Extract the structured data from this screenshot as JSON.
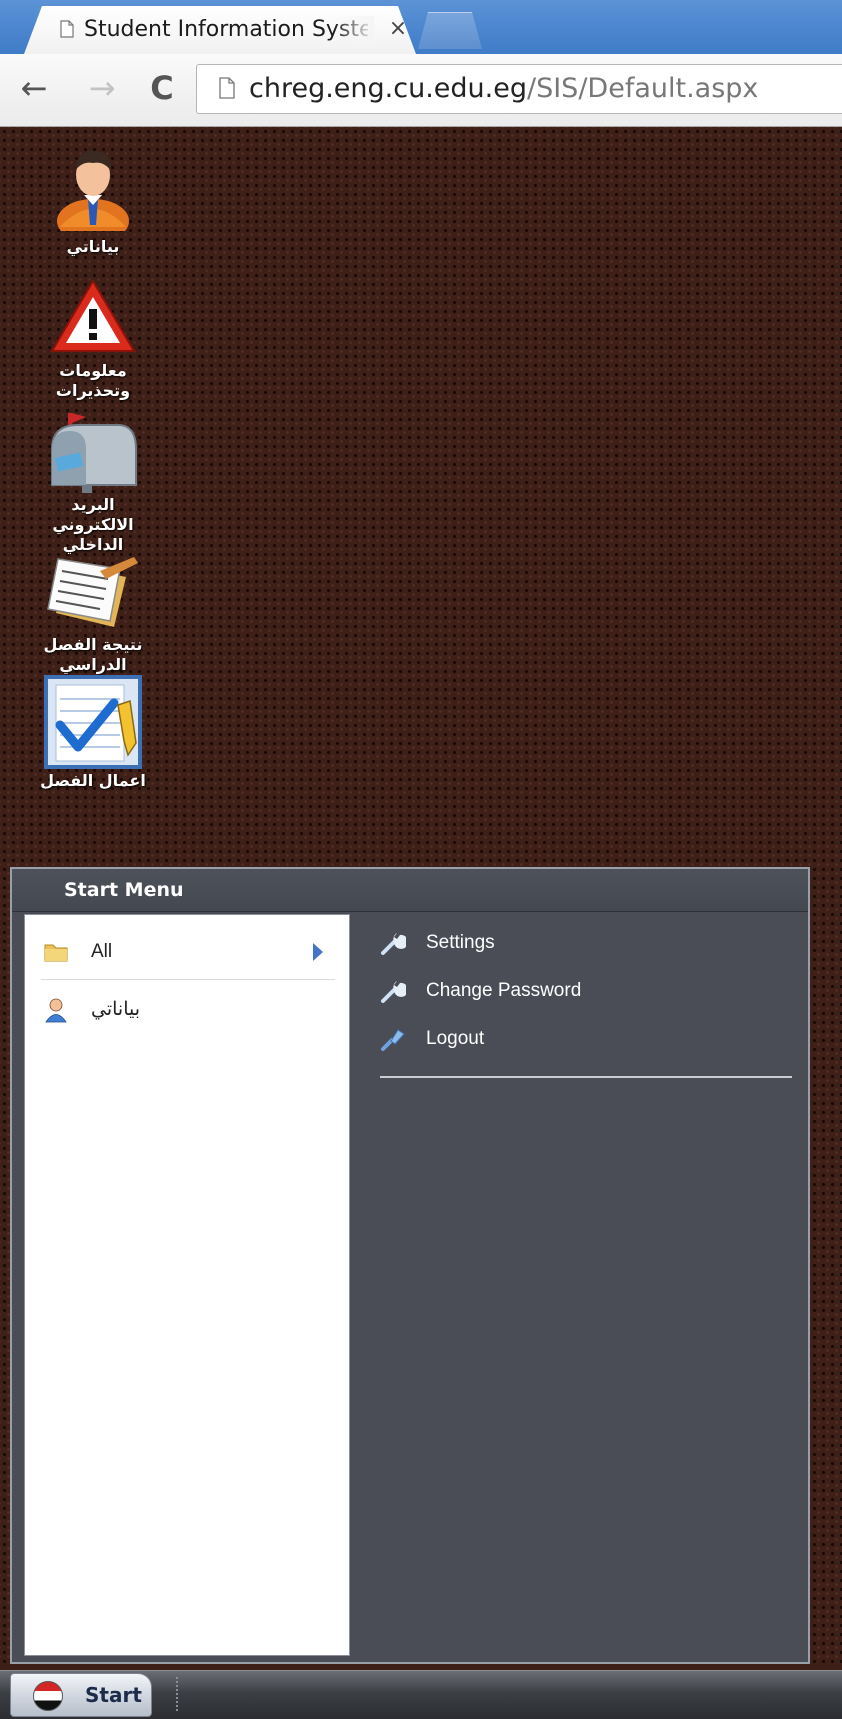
{
  "browser": {
    "tab_title": "Student Information System",
    "tab_close": "×",
    "back_glyph": "←",
    "forward_glyph": "→",
    "reload_glyph": "C",
    "url_host": "chreg.eng.cu.edu.eg",
    "url_path": "/SIS/Default.aspx"
  },
  "desktop": {
    "icons": [
      {
        "label": "بياناتي",
        "icon": "user-icon"
      },
      {
        "label": "معلومات وتحذيرات",
        "icon": "warning-icon"
      },
      {
        "label": "البريد الالكتروني الداخلي",
        "icon": "mailbox-icon"
      },
      {
        "label": "نتيجة الفصل الدراسي",
        "icon": "results-paper-icon"
      },
      {
        "label": "اعمال الفصل",
        "icon": "checklist-icon"
      }
    ]
  },
  "start_menu": {
    "title": "Start Menu",
    "left_items": [
      {
        "label": "All",
        "icon": "folder-icon",
        "has_submenu": true
      },
      {
        "label": "بياناتي",
        "icon": "user-icon"
      }
    ],
    "right_items": [
      {
        "label": "Settings",
        "icon": "wrench-icon"
      },
      {
        "label": "Change Password",
        "icon": "wrench-icon"
      },
      {
        "label": "Logout",
        "icon": "logout-icon"
      }
    ]
  },
  "taskbar": {
    "start_label": "Start",
    "start_icon": "egypt-flag-icon"
  },
  "colors": {
    "desktop_bg": "#3f2018",
    "menu_dark": "#4a4d55",
    "tabbar_blue": "#4a85cf",
    "link_blue": "#3f74c6"
  }
}
